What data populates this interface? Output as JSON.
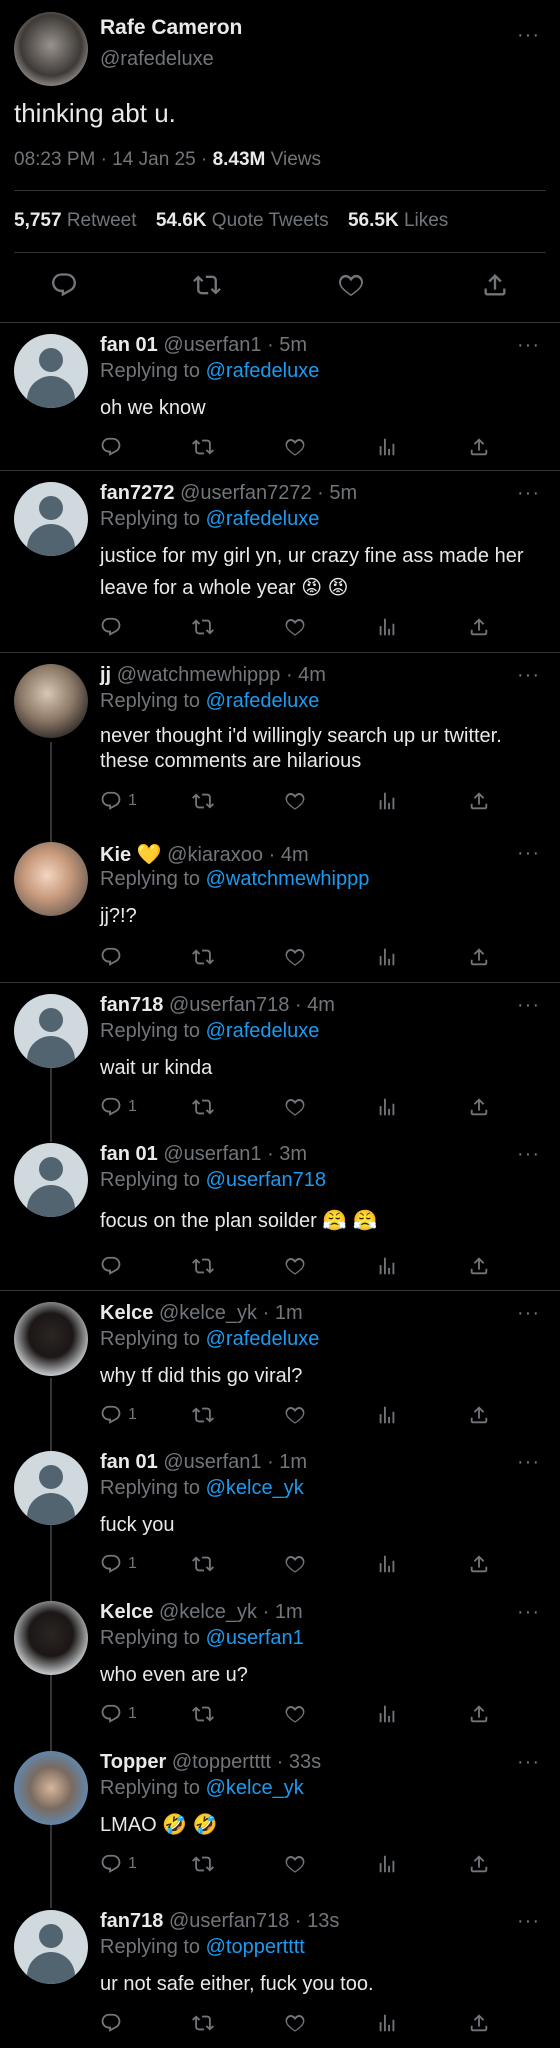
{
  "tweet": {
    "author_name": "Rafe Cameron",
    "author_handle": "@rafedeluxe",
    "text": "thinking abt u.",
    "time_date": "08:23 PM · 14 Jan 25 ·",
    "views_count": "8.43M",
    "views_label": "Views",
    "retweet_count": "5,757",
    "retweet_label": "Retweet",
    "quote_count": "54.6K",
    "quote_label": "Quote Tweets",
    "likes_count": "56.5K",
    "likes_label": "Likes",
    "more": "···"
  },
  "icons": {
    "reply": "reply-icon",
    "retweet": "retweet-icon",
    "like": "heart-icon",
    "views": "analytics-icon",
    "share": "share-icon",
    "more": "more-icon"
  },
  "colors": {
    "background": "#000000",
    "text": "#e7e9ea",
    "muted": "#71767b",
    "link": "#1d9bf0",
    "divider": "#2f3336"
  },
  "replies": [
    {
      "name": "fan 01",
      "meta": "@userfan1 · 5m",
      "replying_prefix": "Replying to",
      "replying_to": "@rafedeluxe",
      "text": "oh we know",
      "reply_count": ""
    },
    {
      "name": "fan7272",
      "meta": "@userfan7272 · 5m",
      "replying_prefix": "Replying to",
      "replying_to": "@rafedeluxe",
      "text": "justice for my girl yn, ur crazy fine ass made her leave for a whole year 😡 😡",
      "reply_count": ""
    },
    {
      "name": "jj",
      "meta": "@watchmewhippp · 4m",
      "replying_prefix": "Replying to",
      "replying_to": "@rafedeluxe",
      "text": "never thought i'd willingly search up ur twitter. these comments are hilarious",
      "reply_count": "1"
    },
    {
      "name": "Kie 💛",
      "meta": "@kiaraxoo · 4m",
      "replying_prefix": "Replying to",
      "replying_to": "@watchmewhippp",
      "text": "jj?!?",
      "reply_count": ""
    },
    {
      "name": "fan718",
      "meta": "@userfan718 · 4m",
      "replying_prefix": "Replying to",
      "replying_to": "@rafedeluxe",
      "text": "wait ur kinda",
      "reply_count": "1"
    },
    {
      "name": "fan 01",
      "meta": "@userfan1 · 3m",
      "replying_prefix": "Replying to",
      "replying_to": "@userfan718",
      "text": "focus on the plan soilder 😤 😤",
      "reply_count": ""
    },
    {
      "name": "Kelce",
      "meta": "@kelce_yk · 1m",
      "replying_prefix": "Replying to",
      "replying_to": "@rafedeluxe",
      "text": "why tf did this go viral?",
      "reply_count": "1"
    },
    {
      "name": "fan 01",
      "meta": "@userfan1 · 1m",
      "replying_prefix": "Replying to",
      "replying_to": "@kelce_yk",
      "text": "fuck you",
      "reply_count": "1"
    },
    {
      "name": "Kelce",
      "meta": "@kelce_yk · 1m",
      "replying_prefix": "Replying to",
      "replying_to": "@userfan1",
      "text": "who even are u?",
      "reply_count": "1"
    },
    {
      "name": "Topper",
      "meta": "@toppertttt · 33s",
      "replying_prefix": "Replying to",
      "replying_to": "@kelce_yk",
      "text": "LMAO 🤣 🤣",
      "reply_count": "1"
    },
    {
      "name": "fan718",
      "meta": "@userfan718 · 13s",
      "replying_prefix": "Replying to",
      "replying_to": "@toppertttt",
      "text": "ur not safe either, fuck you too.",
      "reply_count": ""
    }
  ]
}
